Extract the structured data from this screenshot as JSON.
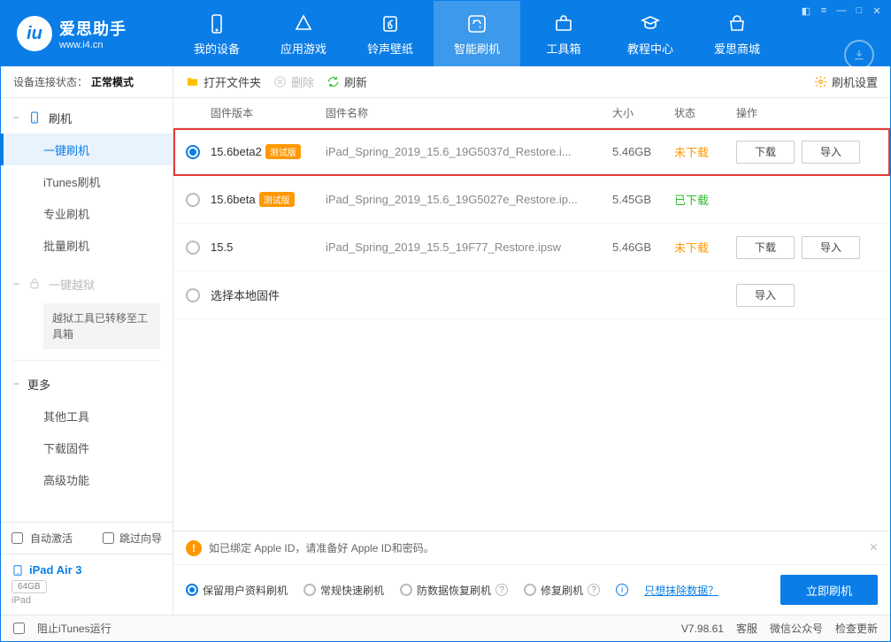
{
  "header": {
    "logo_title": "爱思助手",
    "logo_sub": "www.i4.cn",
    "tabs": [
      {
        "label": "我的设备"
      },
      {
        "label": "应用游戏"
      },
      {
        "label": "铃声壁纸"
      },
      {
        "label": "智能刷机"
      },
      {
        "label": "工具箱"
      },
      {
        "label": "教程中心"
      },
      {
        "label": "爱思商城"
      }
    ]
  },
  "sidebar": {
    "conn_label": "设备连接状态：",
    "conn_value": "正常模式",
    "flash_header": "刷机",
    "flash_items": [
      "一键刷机",
      "iTunes刷机",
      "专业刷机",
      "批量刷机"
    ],
    "jailbreak_header": "一键越狱",
    "jailbreak_note": "越狱工具已转移至工具箱",
    "more_header": "更多",
    "more_items": [
      "其他工具",
      "下载固件",
      "高级功能"
    ],
    "auto_activate": "自动激活",
    "skip_guide": "跳过向导",
    "device_name": "iPad Air 3",
    "device_storage": "64GB",
    "device_type": "iPad"
  },
  "toolbar": {
    "open_folder": "打开文件夹",
    "delete": "删除",
    "refresh": "刷新",
    "settings": "刷机设置"
  },
  "table": {
    "headers": {
      "version": "固件版本",
      "name": "固件名称",
      "size": "大小",
      "status": "状态",
      "action": "操作"
    },
    "rows": [
      {
        "selected": true,
        "version": "15.6beta2",
        "beta": "测试版",
        "name": "iPad_Spring_2019_15.6_19G5037d_Restore.i...",
        "size": "5.46GB",
        "status": "未下载",
        "status_color": "orange",
        "show_download": true,
        "highlighted": true
      },
      {
        "selected": false,
        "version": "15.6beta",
        "beta": "测试版",
        "name": "iPad_Spring_2019_15.6_19G5027e_Restore.ip...",
        "size": "5.45GB",
        "status": "已下载",
        "status_color": "green",
        "show_download": false
      },
      {
        "selected": false,
        "version": "15.5",
        "beta": "",
        "name": "iPad_Spring_2019_15.5_19F77_Restore.ipsw",
        "size": "5.46GB",
        "status": "未下载",
        "status_color": "orange",
        "show_download": true
      },
      {
        "selected": false,
        "version": "选择本地固件",
        "beta": "",
        "name": "",
        "size": "",
        "status": "",
        "status_color": "",
        "show_import_only": true
      }
    ],
    "download_btn": "下载",
    "import_btn": "导入"
  },
  "bottom": {
    "warning": "如已绑定 Apple ID，请准备好 Apple ID和密码。",
    "options": [
      "保留用户资料刷机",
      "常规快速刷机",
      "防数据恢复刷机",
      "修复刷机"
    ],
    "erase_link": "只想抹除数据？",
    "flash_btn": "立即刷机"
  },
  "footer": {
    "block_itunes": "阻止iTunes运行",
    "version": "V7.98.61",
    "support": "客服",
    "wechat": "微信公众号",
    "update": "检查更新"
  }
}
